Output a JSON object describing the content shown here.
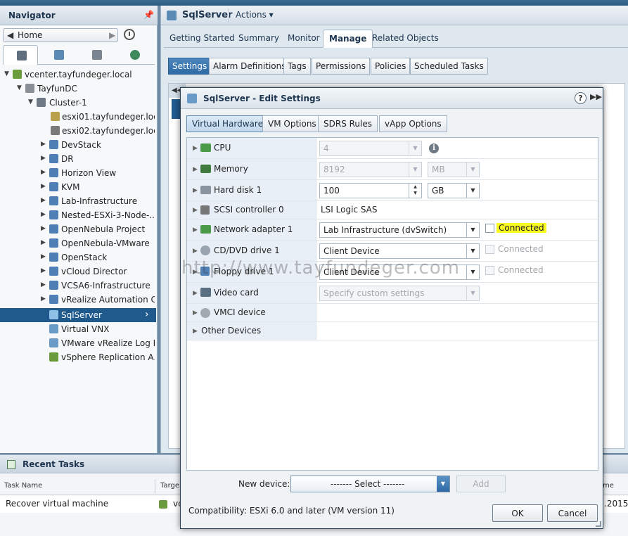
{
  "colors": {
    "selection": "#205a8c",
    "accent": "#2e6aa3",
    "highlight": "#f7f722"
  },
  "navigator": {
    "title": "Navigator",
    "pin_icon": "pin-icon",
    "home_label": "Home",
    "tabs": [
      {
        "icon": "hosts-clusters-icon",
        "active": true
      },
      {
        "icon": "vms-templates-icon",
        "active": false
      },
      {
        "icon": "storage-icon",
        "active": false
      },
      {
        "icon": "networking-icon",
        "active": false
      }
    ],
    "tree": [
      {
        "label": "vcenter.tayfundeger.local"
      },
      {
        "label": "TayfunDC"
      },
      {
        "label": "Cluster-1"
      },
      {
        "label": "esxi01.tayfundeger.local"
      },
      {
        "label": "esxi02.tayfundeger.loc..."
      },
      {
        "label": "DevStack"
      },
      {
        "label": "DR"
      },
      {
        "label": "Horizon View"
      },
      {
        "label": "KVM"
      },
      {
        "label": "Lab-Infrastructure"
      },
      {
        "label": "Nested-ESXi-3-Node-..."
      },
      {
        "label": "OpenNebula Project"
      },
      {
        "label": "OpenNebula-VMware"
      },
      {
        "label": "OpenStack"
      },
      {
        "label": "vCloud Director"
      },
      {
        "label": "VCSA6-Infrastructure"
      },
      {
        "label": "vRealize Automation C..."
      },
      {
        "label": "SqlServer",
        "selected": true
      },
      {
        "label": "Virtual VNX"
      },
      {
        "label": "VMware vRealize Log I..."
      },
      {
        "label": "vSphere Replication A..."
      }
    ]
  },
  "object": {
    "title": "SqlServer",
    "actions_label": "Actions ▾",
    "tabs": [
      "Getting Started",
      "Summary",
      "Monitor",
      "Manage",
      "Related Objects"
    ],
    "active_tab": "Manage",
    "subtabs": [
      "Settings",
      "Alarm Definitions",
      "Tags",
      "Permissions",
      "Policies",
      "Scheduled Tasks"
    ],
    "active_subtab": "Settings"
  },
  "recent_tasks": {
    "title": "Recent Tasks",
    "columns": [
      "Task Name",
      "Targe",
      "me"
    ],
    "rows": [
      {
        "task_name": "Recover virtual machine",
        "target": "vc",
        "time": ".2015"
      }
    ]
  },
  "dialog": {
    "title": "SqlServer - Edit Settings",
    "tabs": [
      "Virtual Hardware",
      "VM Options",
      "SDRS Rules",
      "vApp Options"
    ],
    "active_tab": "Virtual Hardware",
    "hardware": {
      "cpu": {
        "label": "CPU",
        "value": "4"
      },
      "memory": {
        "label": "Memory",
        "value": "8192",
        "unit": "MB"
      },
      "hard_disk": {
        "label": "Hard disk 1",
        "value": "100",
        "unit": "GB"
      },
      "scsi": {
        "label": "SCSI controller 0",
        "value": "LSI Logic SAS"
      },
      "network": {
        "label": "Network adapter 1",
        "value": "Lab Infrastructure (dvSwitch)",
        "connected_label": "Connected"
      },
      "cddvd": {
        "label": "CD/DVD drive 1",
        "value": "Client Device",
        "connected_label": "Connected"
      },
      "floppy": {
        "label": "Floppy drive 1",
        "value": "Client Device",
        "connected_label": "Connected"
      },
      "video": {
        "label": "Video card",
        "value": "Specify custom settings"
      },
      "vmci": {
        "label": "VMCI device"
      },
      "other": {
        "label": "Other Devices"
      }
    },
    "new_device_label": "New device:",
    "new_device_value": "------- Select -------",
    "add_label": "Add",
    "compatibility": "Compatibility: ESXi 6.0 and later (VM version 11)",
    "ok_label": "OK",
    "cancel_label": "Cancel"
  },
  "watermark": "http://www.tayfundeger.com"
}
